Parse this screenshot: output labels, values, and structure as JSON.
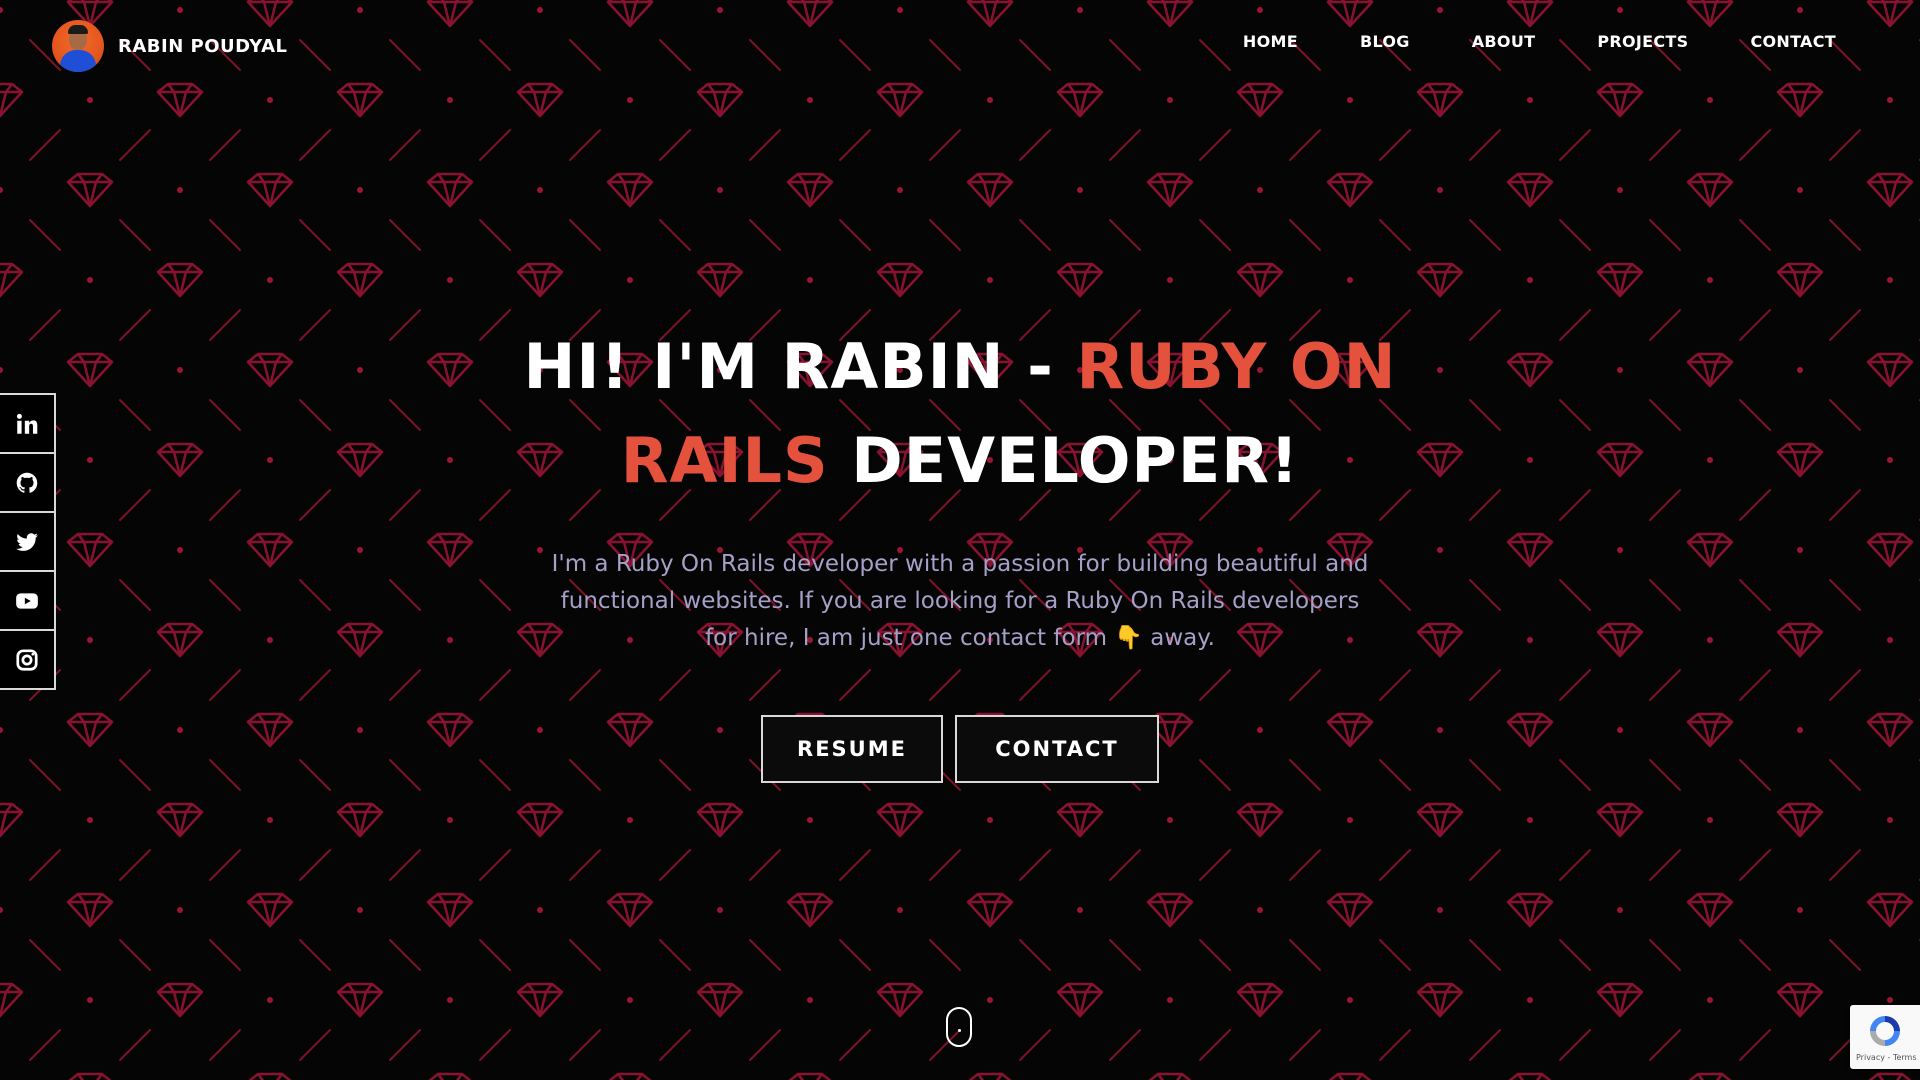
{
  "brand": {
    "name": "RABIN POUDYAL"
  },
  "nav": {
    "items": [
      "HOME",
      "BLOG",
      "ABOUT",
      "PROJECTS",
      "CONTACT"
    ]
  },
  "social": {
    "icons": [
      "linkedin-icon",
      "github-icon",
      "twitter-icon",
      "youtube-icon",
      "instagram-icon"
    ]
  },
  "hero": {
    "title_part1": "HI! I'M RABIN - ",
    "title_accent1": "RUBY ON",
    "title_accent2": "RAILS",
    "title_part2": " DEVELOPER!",
    "description": "I'm a Ruby On Rails developer with a passion for building beautiful and functional websites. If you are looking for a Ruby On Rails developers for hire, I am just one contact form 👇 away.",
    "buttons": {
      "resume": "RESUME",
      "contact": "CONTACT"
    }
  },
  "recaptcha": {
    "terms": "Privacy - Terms"
  },
  "colors": {
    "background": "#050505",
    "accent": "#e4513c",
    "pattern": "#8a1230",
    "description_text": "#a4a0c8"
  }
}
